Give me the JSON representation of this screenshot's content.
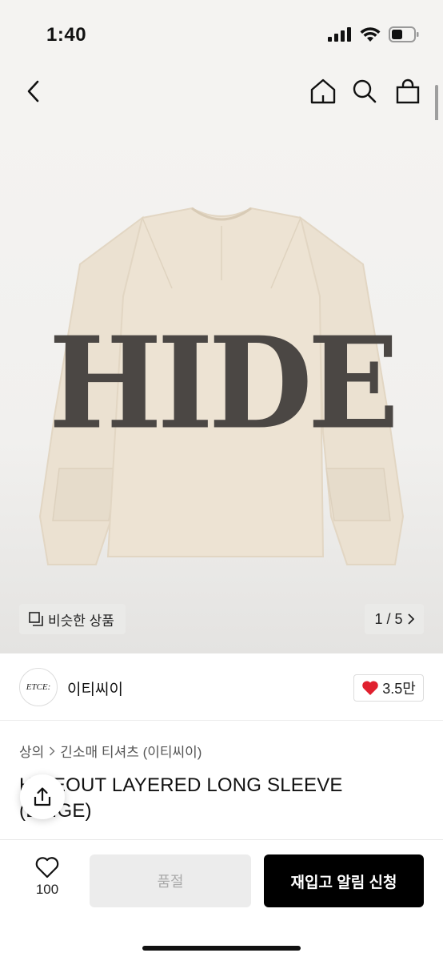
{
  "status": {
    "time": "1:40"
  },
  "product": {
    "graphic_text": "HIDE",
    "similar_label": "비슷한 상품",
    "page_counter": "1 / 5"
  },
  "brand": {
    "logo_text": "ETCE:",
    "name": "이티씨이",
    "likes": "3.5만"
  },
  "breadcrumb": [
    "상의",
    "긴소매 티셔츠 (이티씨이)"
  ],
  "title": "HIDEOUT LAYERED LONG SLEEVE (BEIGE)",
  "bottom": {
    "wish_count": "100",
    "soldout_label": "품절",
    "restock_label": "재입고 알림 신청"
  },
  "colors": {
    "accent": "#e0202e",
    "garment": "#ede3d3",
    "print": "#4b4744",
    "cta": "#000000"
  },
  "icons": [
    "back-icon",
    "home-icon",
    "search-icon",
    "shopping-bag-icon",
    "similar-items-icon",
    "chevron-right-icon",
    "heart-filled-icon",
    "chevron-breadcrumb-icon",
    "share-icon",
    "heart-outline-icon"
  ]
}
